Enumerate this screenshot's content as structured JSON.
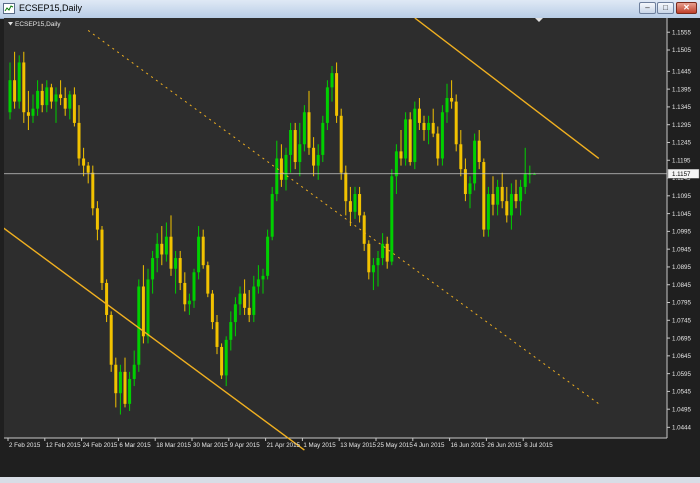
{
  "window": {
    "title": "ECSEP15,Daily",
    "buttons": {
      "minimize": "–",
      "maximize": "□",
      "close": "✕"
    }
  },
  "chart_label": "ECSEP15,Daily",
  "colors": {
    "background": "#2d2d2d",
    "bull": "#00d000",
    "bear": "#f2c200",
    "trendline": "#f0b020",
    "axis_text": "#e6e6e6",
    "price_line": "#c8c8c8"
  },
  "chart_data": {
    "type": "candlestick",
    "symbol": "ECSEP15",
    "timeframe": "Daily",
    "current_price": "1.1157",
    "ylim": [
      1.0414,
      1.1595
    ],
    "y_ticks": [
      "1.1555",
      "1.1505",
      "1.1445",
      "1.1395",
      "1.1345",
      "1.1295",
      "1.1245",
      "1.1195",
      "1.1145",
      "1.1095",
      "1.1045",
      "1.0995",
      "1.0945",
      "1.0895",
      "1.0845",
      "1.0795",
      "1.0745",
      "1.0695",
      "1.0645",
      "1.0595",
      "1.0545",
      "1.0495",
      "1.0444"
    ],
    "y_tick_values": [
      1.1555,
      1.1505,
      1.1445,
      1.1395,
      1.1345,
      1.1295,
      1.1245,
      1.1195,
      1.1145,
      1.1095,
      1.1045,
      1.0995,
      1.0945,
      1.0895,
      1.0845,
      1.0795,
      1.0745,
      1.0695,
      1.0645,
      1.0595,
      1.0545,
      1.0495,
      1.0444
    ],
    "x_ticks": [
      "2 Feb 2015",
      "12 Feb 2015",
      "24 Feb 2015",
      "6 Mar 2015",
      "18 Mar 2015",
      "30 Mar 2015",
      "9 Apr 2015",
      "21 Apr 2015",
      "1 May 2015",
      "13 May 2015",
      "25 May 2015",
      "4 Jun 2015",
      "16 Jun 2015",
      "26 Jun 2015",
      "8 Jul 2015"
    ],
    "x_tick_bars": [
      0,
      8,
      16,
      24,
      32,
      40,
      48,
      56,
      64,
      72,
      80,
      88,
      96,
      104,
      112
    ],
    "n_bars": 115,
    "bars": [
      [
        1.133,
        1.147,
        1.131,
        1.142
      ],
      [
        1.142,
        1.15,
        1.134,
        1.136
      ],
      [
        1.136,
        1.149,
        1.134,
        1.147
      ],
      [
        1.147,
        1.15,
        1.13,
        1.133
      ],
      [
        1.133,
        1.139,
        1.128,
        1.132
      ],
      [
        1.132,
        1.138,
        1.13,
        1.134
      ],
      [
        1.134,
        1.142,
        1.132,
        1.139
      ],
      [
        1.139,
        1.141,
        1.133,
        1.135
      ],
      [
        1.135,
        1.142,
        1.133,
        1.14
      ],
      [
        1.14,
        1.141,
        1.134,
        1.136
      ],
      [
        1.136,
        1.14,
        1.13,
        1.138
      ],
      [
        1.138,
        1.142,
        1.135,
        1.137
      ],
      [
        1.137,
        1.14,
        1.132,
        1.134
      ],
      [
        1.134,
        1.139,
        1.131,
        1.138
      ],
      [
        1.138,
        1.14,
        1.129,
        1.13
      ],
      [
        1.13,
        1.135,
        1.118,
        1.12
      ],
      [
        1.12,
        1.123,
        1.115,
        1.118
      ],
      [
        1.118,
        1.119,
        1.113,
        1.116
      ],
      [
        1.116,
        1.118,
        1.104,
        1.106
      ],
      [
        1.106,
        1.108,
        1.097,
        1.1
      ],
      [
        1.1,
        1.101,
        1.083,
        1.085
      ],
      [
        1.085,
        1.086,
        1.074,
        1.076
      ],
      [
        1.076,
        1.077,
        1.06,
        1.062
      ],
      [
        1.062,
        1.064,
        1.05,
        1.054
      ],
      [
        1.054,
        1.062,
        1.048,
        1.06
      ],
      [
        1.06,
        1.064,
        1.05,
        1.051
      ],
      [
        1.051,
        1.06,
        1.049,
        1.058
      ],
      [
        1.058,
        1.066,
        1.056,
        1.062
      ],
      [
        1.062,
        1.086,
        1.06,
        1.084
      ],
      [
        1.084,
        1.09,
        1.068,
        1.07
      ],
      [
        1.07,
        1.089,
        1.068,
        1.086
      ],
      [
        1.086,
        1.094,
        1.082,
        1.092
      ],
      [
        1.092,
        1.099,
        1.088,
        1.096
      ],
      [
        1.096,
        1.101,
        1.09,
        1.093
      ],
      [
        1.093,
        1.102,
        1.091,
        1.098
      ],
      [
        1.098,
        1.104,
        1.087,
        1.089
      ],
      [
        1.089,
        1.094,
        1.082,
        1.092
      ],
      [
        1.092,
        1.094,
        1.083,
        1.085
      ],
      [
        1.085,
        1.088,
        1.077,
        1.079
      ],
      [
        1.079,
        1.082,
        1.076,
        1.08
      ],
      [
        1.08,
        1.089,
        1.078,
        1.088
      ],
      [
        1.088,
        1.101,
        1.086,
        1.098
      ],
      [
        1.098,
        1.1,
        1.089,
        1.09
      ],
      [
        1.09,
        1.091,
        1.081,
        1.082
      ],
      [
        1.082,
        1.083,
        1.072,
        1.074
      ],
      [
        1.074,
        1.076,
        1.065,
        1.067
      ],
      [
        1.067,
        1.068,
        1.058,
        1.059
      ],
      [
        1.059,
        1.07,
        1.056,
        1.069
      ],
      [
        1.069,
        1.077,
        1.066,
        1.074
      ],
      [
        1.074,
        1.081,
        1.07,
        1.079
      ],
      [
        1.079,
        1.084,
        1.076,
        1.082
      ],
      [
        1.082,
        1.086,
        1.076,
        1.078
      ],
      [
        1.078,
        1.083,
        1.074,
        1.076
      ],
      [
        1.076,
        1.087,
        1.074,
        1.084
      ],
      [
        1.084,
        1.09,
        1.082,
        1.086
      ],
      [
        1.086,
        1.089,
        1.082,
        1.087
      ],
      [
        1.087,
        1.1,
        1.086,
        1.098
      ],
      [
        1.098,
        1.112,
        1.097,
        1.11
      ],
      [
        1.11,
        1.125,
        1.108,
        1.12
      ],
      [
        1.12,
        1.124,
        1.112,
        1.114
      ],
      [
        1.114,
        1.123,
        1.111,
        1.121
      ],
      [
        1.121,
        1.13,
        1.116,
        1.128
      ],
      [
        1.128,
        1.13,
        1.117,
        1.119
      ],
      [
        1.119,
        1.13,
        1.115,
        1.124
      ],
      [
        1.124,
        1.135,
        1.122,
        1.133
      ],
      [
        1.133,
        1.139,
        1.121,
        1.123
      ],
      [
        1.123,
        1.126,
        1.115,
        1.118
      ],
      [
        1.118,
        1.124,
        1.114,
        1.121
      ],
      [
        1.121,
        1.132,
        1.119,
        1.13
      ],
      [
        1.13,
        1.142,
        1.128,
        1.14
      ],
      [
        1.14,
        1.146,
        1.136,
        1.144
      ],
      [
        1.144,
        1.147,
        1.13,
        1.132
      ],
      [
        1.132,
        1.134,
        1.114,
        1.116
      ],
      [
        1.116,
        1.118,
        1.104,
        1.108
      ],
      [
        1.108,
        1.112,
        1.101,
        1.105
      ],
      [
        1.105,
        1.112,
        1.103,
        1.11
      ],
      [
        1.11,
        1.112,
        1.102,
        1.104
      ],
      [
        1.104,
        1.105,
        1.094,
        1.096
      ],
      [
        1.096,
        1.097,
        1.086,
        1.088
      ],
      [
        1.088,
        1.092,
        1.083,
        1.09
      ],
      [
        1.09,
        1.094,
        1.084,
        1.092
      ],
      [
        1.092,
        1.099,
        1.09,
        1.096
      ],
      [
        1.096,
        1.098,
        1.089,
        1.091
      ],
      [
        1.091,
        1.117,
        1.09,
        1.115
      ],
      [
        1.115,
        1.124,
        1.11,
        1.122
      ],
      [
        1.122,
        1.128,
        1.118,
        1.12
      ],
      [
        1.12,
        1.133,
        1.118,
        1.131
      ],
      [
        1.131,
        1.133,
        1.118,
        1.119
      ],
      [
        1.119,
        1.136,
        1.117,
        1.134
      ],
      [
        1.134,
        1.137,
        1.128,
        1.13
      ],
      [
        1.13,
        1.132,
        1.125,
        1.128
      ],
      [
        1.128,
        1.132,
        1.124,
        1.13
      ],
      [
        1.13,
        1.134,
        1.126,
        1.127
      ],
      [
        1.127,
        1.129,
        1.118,
        1.12
      ],
      [
        1.12,
        1.135,
        1.118,
        1.133
      ],
      [
        1.133,
        1.141,
        1.13,
        1.137
      ],
      [
        1.137,
        1.142,
        1.134,
        1.136
      ],
      [
        1.136,
        1.138,
        1.122,
        1.124
      ],
      [
        1.124,
        1.128,
        1.115,
        1.117
      ],
      [
        1.117,
        1.12,
        1.108,
        1.11
      ],
      [
        1.11,
        1.115,
        1.106,
        1.113
      ],
      [
        1.113,
        1.127,
        1.111,
        1.125
      ],
      [
        1.125,
        1.128,
        1.117,
        1.119
      ],
      [
        1.119,
        1.12,
        1.098,
        1.1
      ],
      [
        1.1,
        1.112,
        1.098,
        1.11
      ],
      [
        1.11,
        1.115,
        1.104,
        1.107
      ],
      [
        1.107,
        1.114,
        1.104,
        1.112
      ],
      [
        1.112,
        1.116,
        1.106,
        1.108
      ],
      [
        1.108,
        1.112,
        1.102,
        1.104
      ],
      [
        1.104,
        1.113,
        1.1,
        1.11
      ],
      [
        1.11,
        1.114,
        1.106,
        1.108
      ],
      [
        1.108,
        1.114,
        1.104,
        1.112
      ],
      [
        1.112,
        1.123,
        1.11,
        1.1157
      ],
      [
        1.1157,
        1.118,
        1.113,
        1.1157
      ],
      [
        1.1157,
        1.116,
        1.1157,
        1.1157
      ]
    ],
    "trendlines": [
      {
        "style": "solid",
        "from": {
          "bar": -2,
          "price": 1.101
        },
        "to": {
          "bar": 64,
          "price": 1.038
        }
      },
      {
        "style": "solid",
        "from": {
          "bar": 88,
          "price": 1.1595
        },
        "to": {
          "bar": 128,
          "price": 1.12
        }
      },
      {
        "style": "dotted",
        "from": {
          "bar": 17,
          "price": 1.156
        },
        "to": {
          "bar": 128,
          "price": 1.051
        }
      }
    ]
  }
}
